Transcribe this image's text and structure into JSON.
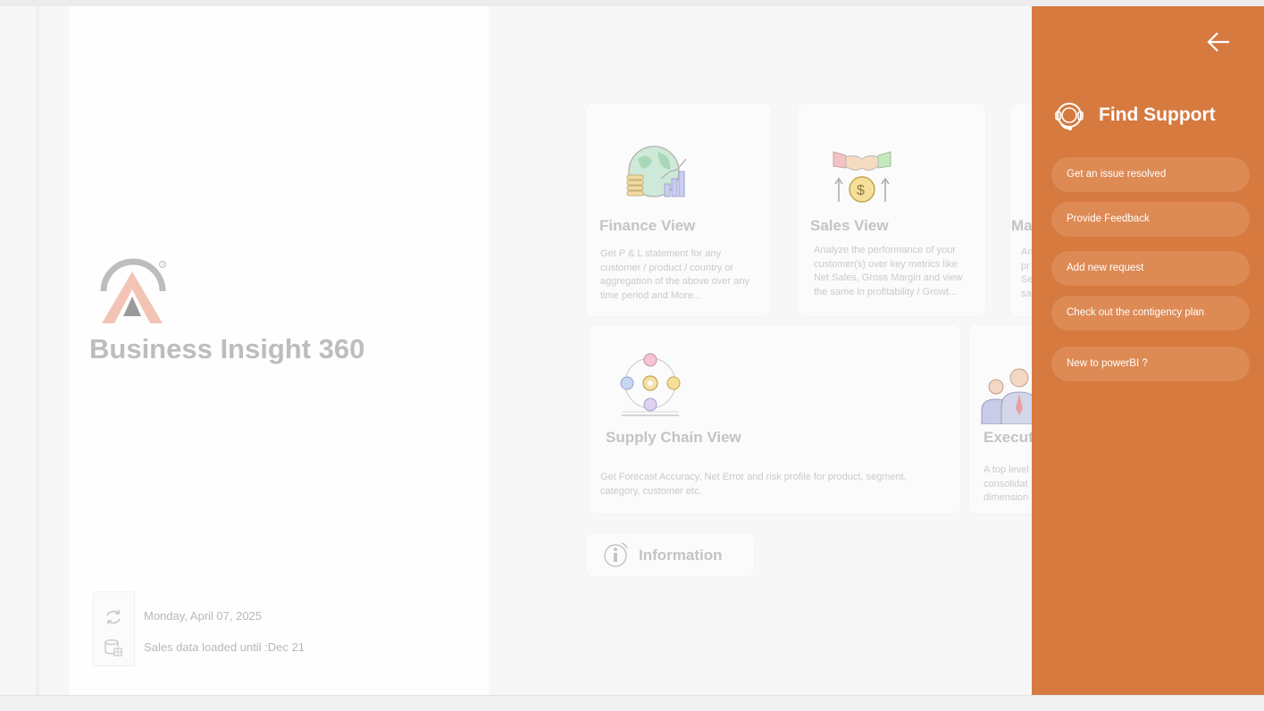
{
  "app": {
    "title": "Business Insight 360",
    "date": "Monday, April 07, 2025",
    "data_status": "Sales data loaded until :Dec 21"
  },
  "cards": {
    "finance": {
      "title": "Finance View",
      "description": "Get P & L statement for any customer / product / country or aggregation of the above over any time period and More..."
    },
    "sales": {
      "title": "Sales View",
      "description": "Analyze the performance of your customer(s) over key metrics like Net Sales, Gross Margin and view the same in profitability / Growt..."
    },
    "marketing": {
      "title": "Ma",
      "description": "An pr Se sa"
    },
    "supply_chain": {
      "title": "Supply Chain View",
      "description": "Get Forecast Accuracy, Net Error and risk profile for product, segment, category, customer etc."
    },
    "executive": {
      "title": "Execut",
      "description": "A top level consolidat dimension"
    },
    "information": {
      "title": "Information"
    }
  },
  "support": {
    "title": "Find Support",
    "buttons": [
      {
        "label": "Get an issue resolved"
      },
      {
        "label": "Provide Feedback"
      },
      {
        "label": "Add new request"
      },
      {
        "label": "Check out the contigency plan"
      },
      {
        "label": "New to powerBI ?"
      }
    ]
  },
  "colors": {
    "support_panel": "#d67a40",
    "support_button": "#dd8a55",
    "dimmed_text": "#c4c4c4"
  },
  "icons": {
    "logo": "atliq-logo",
    "refresh": "refresh-icon",
    "database": "database-icon",
    "finance": "globe-coins-chart-icon",
    "sales": "handshake-dollar-icon",
    "supply_chain": "network-gear-icon",
    "executive": "executives-icon",
    "information": "info-icon",
    "back": "arrow-left-icon",
    "support": "headset-icon"
  }
}
